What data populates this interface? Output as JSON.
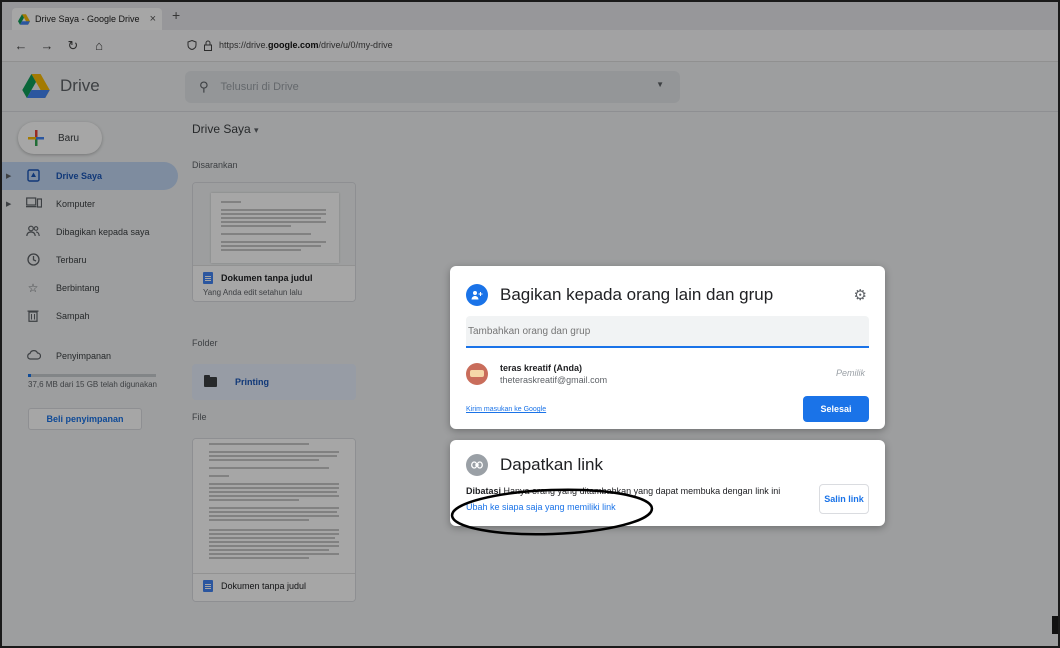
{
  "browser": {
    "tab_title": "Drive Saya - Google Drive",
    "tab_close": "×",
    "new_tab": "+",
    "url_prefix": "https://drive.",
    "url_domain": "google.com",
    "url_path": "/drive/u/0/my-drive"
  },
  "app": {
    "name": "Drive",
    "search_placeholder": "Telusuri di Drive",
    "new_button": "Baru"
  },
  "sidebar": {
    "items": [
      {
        "label": "Drive Saya"
      },
      {
        "label": "Komputer"
      },
      {
        "label": "Dibagikan kepada saya"
      },
      {
        "label": "Terbaru"
      },
      {
        "label": "Berbintang"
      },
      {
        "label": "Sampah"
      },
      {
        "label": "Penyimpanan"
      }
    ],
    "storage_text": "37,6 MB dari 15 GB telah digunakan",
    "storage_fraction": 0.0025,
    "buy_storage": "Beli penyimpanan"
  },
  "main": {
    "title": "Drive Saya",
    "suggested_label": "Disarankan",
    "suggested_doc_name": "Dokumen tanpa judul",
    "suggested_doc_sub": "Yang Anda edit setahun lalu",
    "folder_label": "Folder",
    "folder_name": "Printing",
    "file_label": "File",
    "file_doc_name": "Dokumen tanpa judul"
  },
  "share_dialog": {
    "title": "Bagikan kepada orang lain dan grup",
    "input_placeholder": "Tambahkan orang dan grup",
    "person_name": "teras kreatif (Anda)",
    "person_email": "theteraskreatif@gmail.com",
    "person_role": "Pemilik",
    "feedback_link": "Kirim masukan ke Google",
    "done_button": "Selesai"
  },
  "link_dialog": {
    "title": "Dapatkan link",
    "desc_bold": "Dibatasi",
    "desc_rest": " Hanya orang yang ditambahkan yang dapat membuka dengan link ini",
    "change_link": "Ubah ke siapa saja yang memiliki link",
    "copy_button": "Salin link"
  },
  "colors": {
    "accent": "#1a73e8",
    "active_nav": "#c2d7f5"
  }
}
